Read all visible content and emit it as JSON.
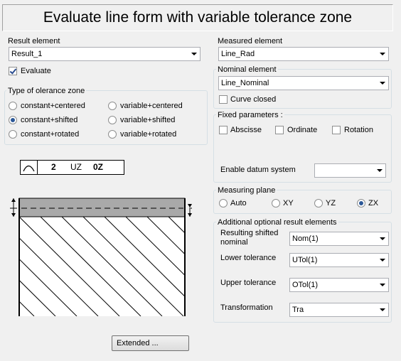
{
  "title": "Evaluate line form with variable tolerance zone",
  "result_element": {
    "label": "Result element",
    "value": "Result_1",
    "evaluate_label": "Evaluate",
    "evaluate_checked": true
  },
  "tolerance_zone": {
    "label": "Type of olerance zone",
    "options": [
      "constant+centered",
      "constant+shifted",
      "constant+rotated",
      "variable+centered",
      "variable+shifted",
      "variable+rotated"
    ],
    "selected": "constant+shifted"
  },
  "frame": {
    "symbol_icon": "arc-icon",
    "value": "2",
    "modifier1": "UZ",
    "modifier2": "0Z"
  },
  "measured_element": {
    "label": "Measured element",
    "value": "Line_Rad"
  },
  "nominal_element": {
    "label": "Nominal element",
    "value": "Line_Nominal",
    "curve_closed_label": "Curve closed",
    "curve_closed_checked": false
  },
  "fixed_parameters": {
    "label": "Fixed parameters :",
    "abscisse": "Abscisse",
    "ordinate": "Ordinate",
    "rotation": "Rotation",
    "enable_datum_label": "Enable datum system",
    "enable_datum_value": ""
  },
  "measuring_plane": {
    "label": "Measuring plane",
    "options": [
      "Auto",
      "XY",
      "YZ",
      "ZX"
    ],
    "selected": "ZX"
  },
  "additional": {
    "label": "Additional optional result elements",
    "shifted_label_1": "Resulting shifted",
    "shifted_label_2": "nominal",
    "shifted_value": "Nom(1)",
    "lower_label": "Lower tolerance",
    "lower_value": "UTol(1)",
    "upper_label": "Upper tolerance",
    "upper_value": "OTol(1)",
    "transform_label": "Transformation",
    "transform_value": "Tra"
  },
  "extended_button": "Extended ..."
}
